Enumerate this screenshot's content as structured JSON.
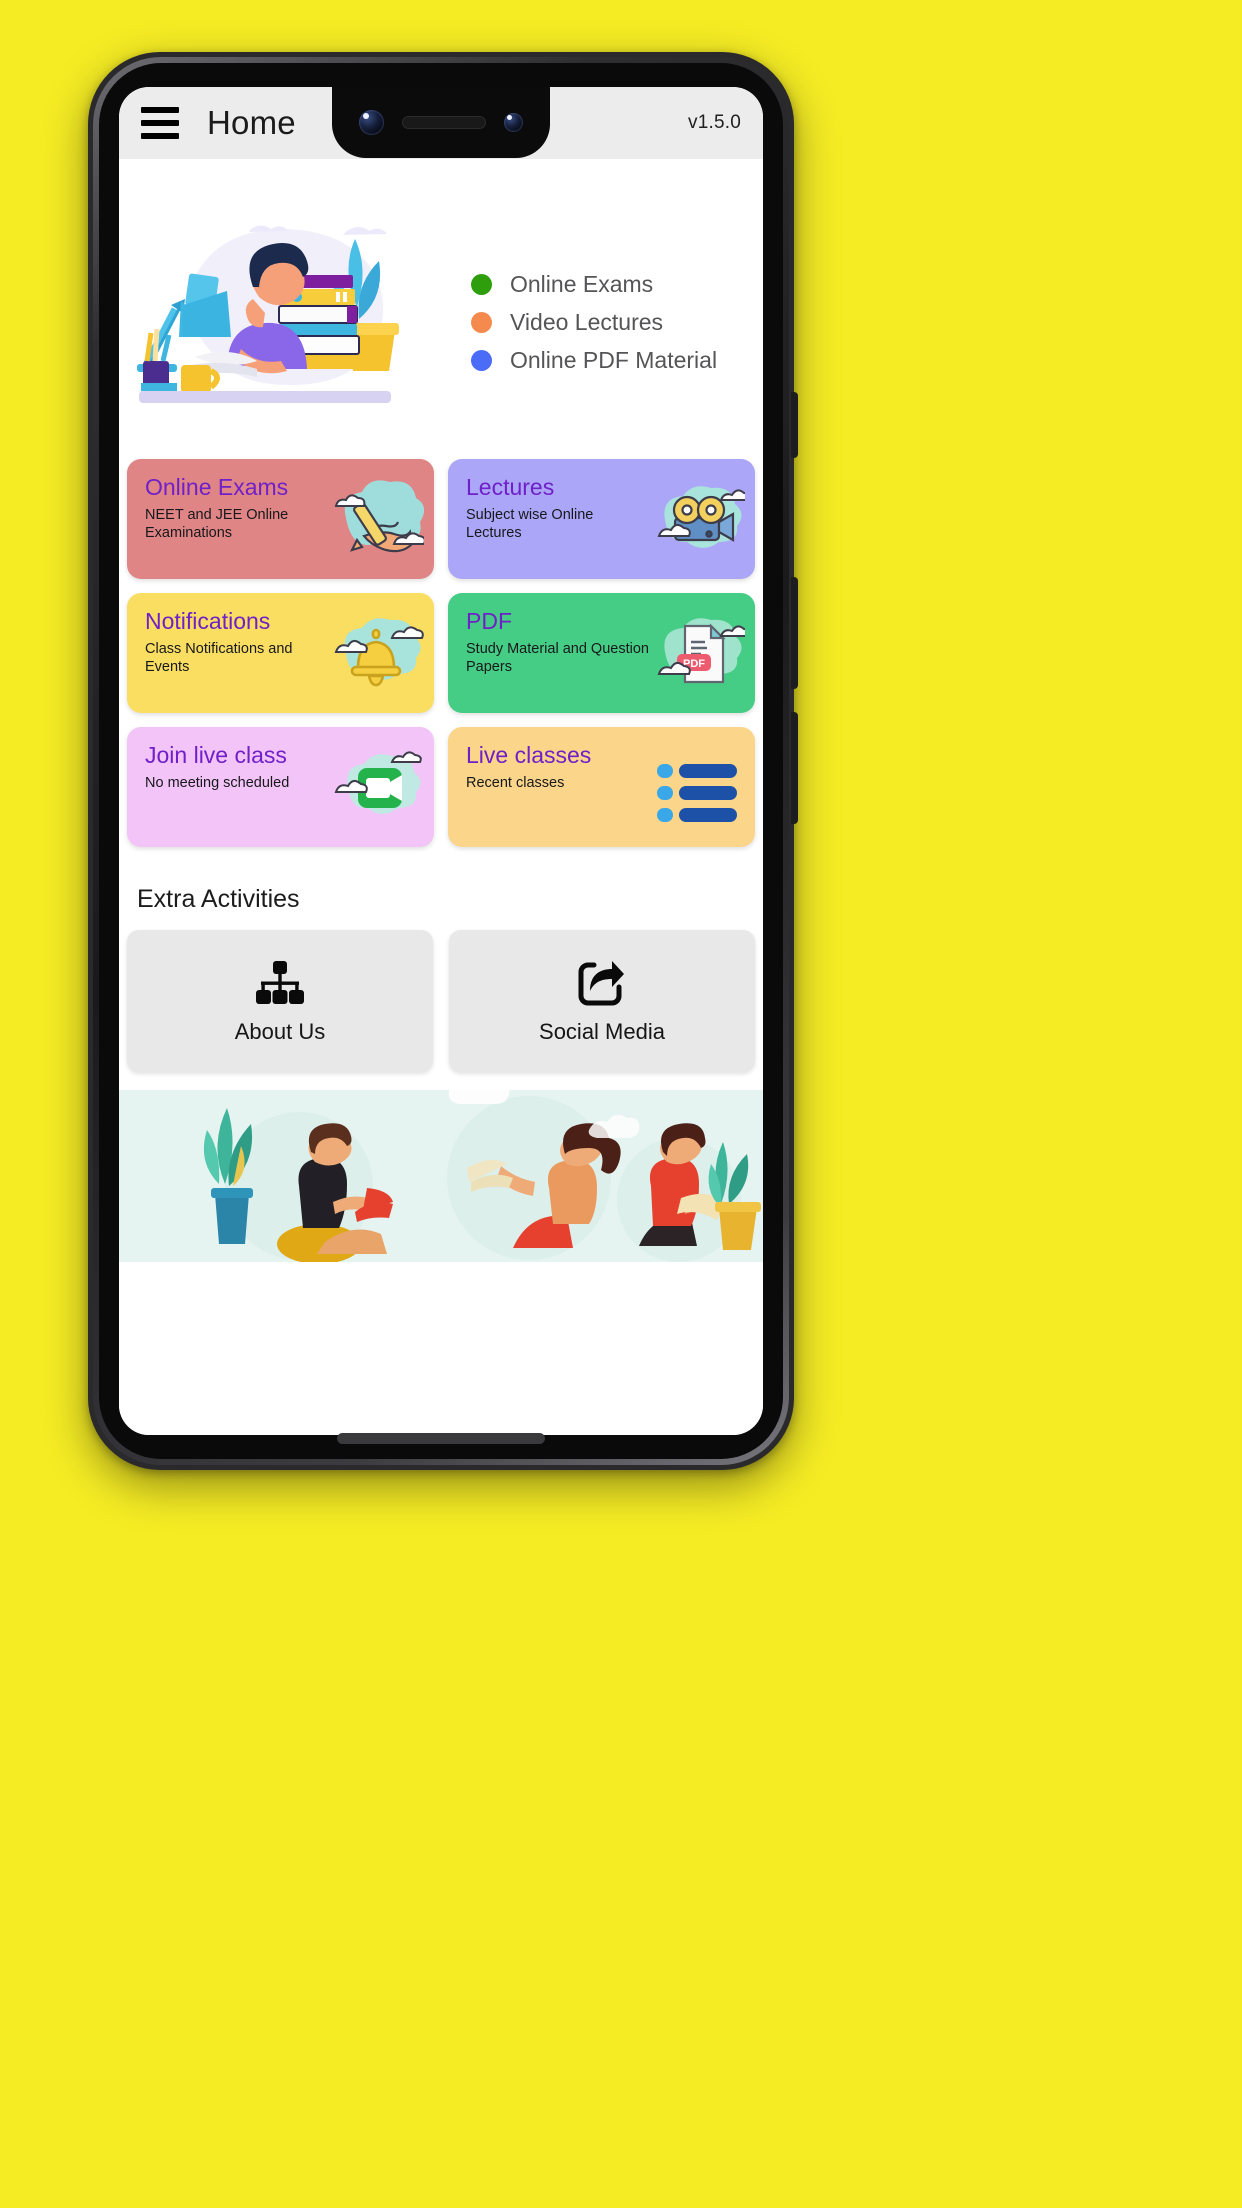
{
  "appbar": {
    "menu_icon": "hamburger-menu-icon",
    "title": "Home",
    "version": "v1.5.0"
  },
  "hero": {
    "illustration": "student-studying-at-desk-illustration",
    "legend": [
      {
        "label": "Online Exams",
        "color": "#2e9e0c"
      },
      {
        "label": "Video Lectures",
        "color": "#f58a4e"
      },
      {
        "label": "Online PDF Material",
        "color": "#4a6cf7"
      }
    ]
  },
  "feature_cards": [
    {
      "title": "Online Exams",
      "subtitle": "NEET and JEE Online Examinations",
      "bg": "#e08585",
      "icon": "hand-writing-pencil-icon"
    },
    {
      "title": "Lectures",
      "subtitle": "Subject wise Online Lectures",
      "bg": "#aba6f7",
      "icon": "film-projector-icon"
    },
    {
      "title": "Notifications",
      "subtitle": "Class Notifications and Events",
      "bg": "#fade62",
      "icon": "bell-icon"
    },
    {
      "title": "PDF",
      "subtitle": "Study Material and Question Papers",
      "bg": "#46cd85",
      "icon": "pdf-document-icon"
    },
    {
      "title": "Join live class",
      "subtitle": "No meeting scheduled",
      "bg": "#f3c4f7",
      "icon": "video-camera-icon"
    },
    {
      "title": "Live classes",
      "subtitle": "Recent classes",
      "bg": "#fad58a",
      "icon": "list-icon"
    }
  ],
  "extra_activities": {
    "heading": "Extra Activities",
    "tiles": [
      {
        "label": "About Us",
        "icon": "sitemap-icon"
      },
      {
        "label": "Social Media",
        "icon": "share-icon"
      }
    ]
  },
  "footer": {
    "illustration": "people-reading-books-illustration"
  },
  "theme": {
    "page_background": "#f5ec24",
    "appbar_background": "#ececec",
    "title_accent": "#7020c8",
    "tile_background": "#e8e8e8"
  }
}
